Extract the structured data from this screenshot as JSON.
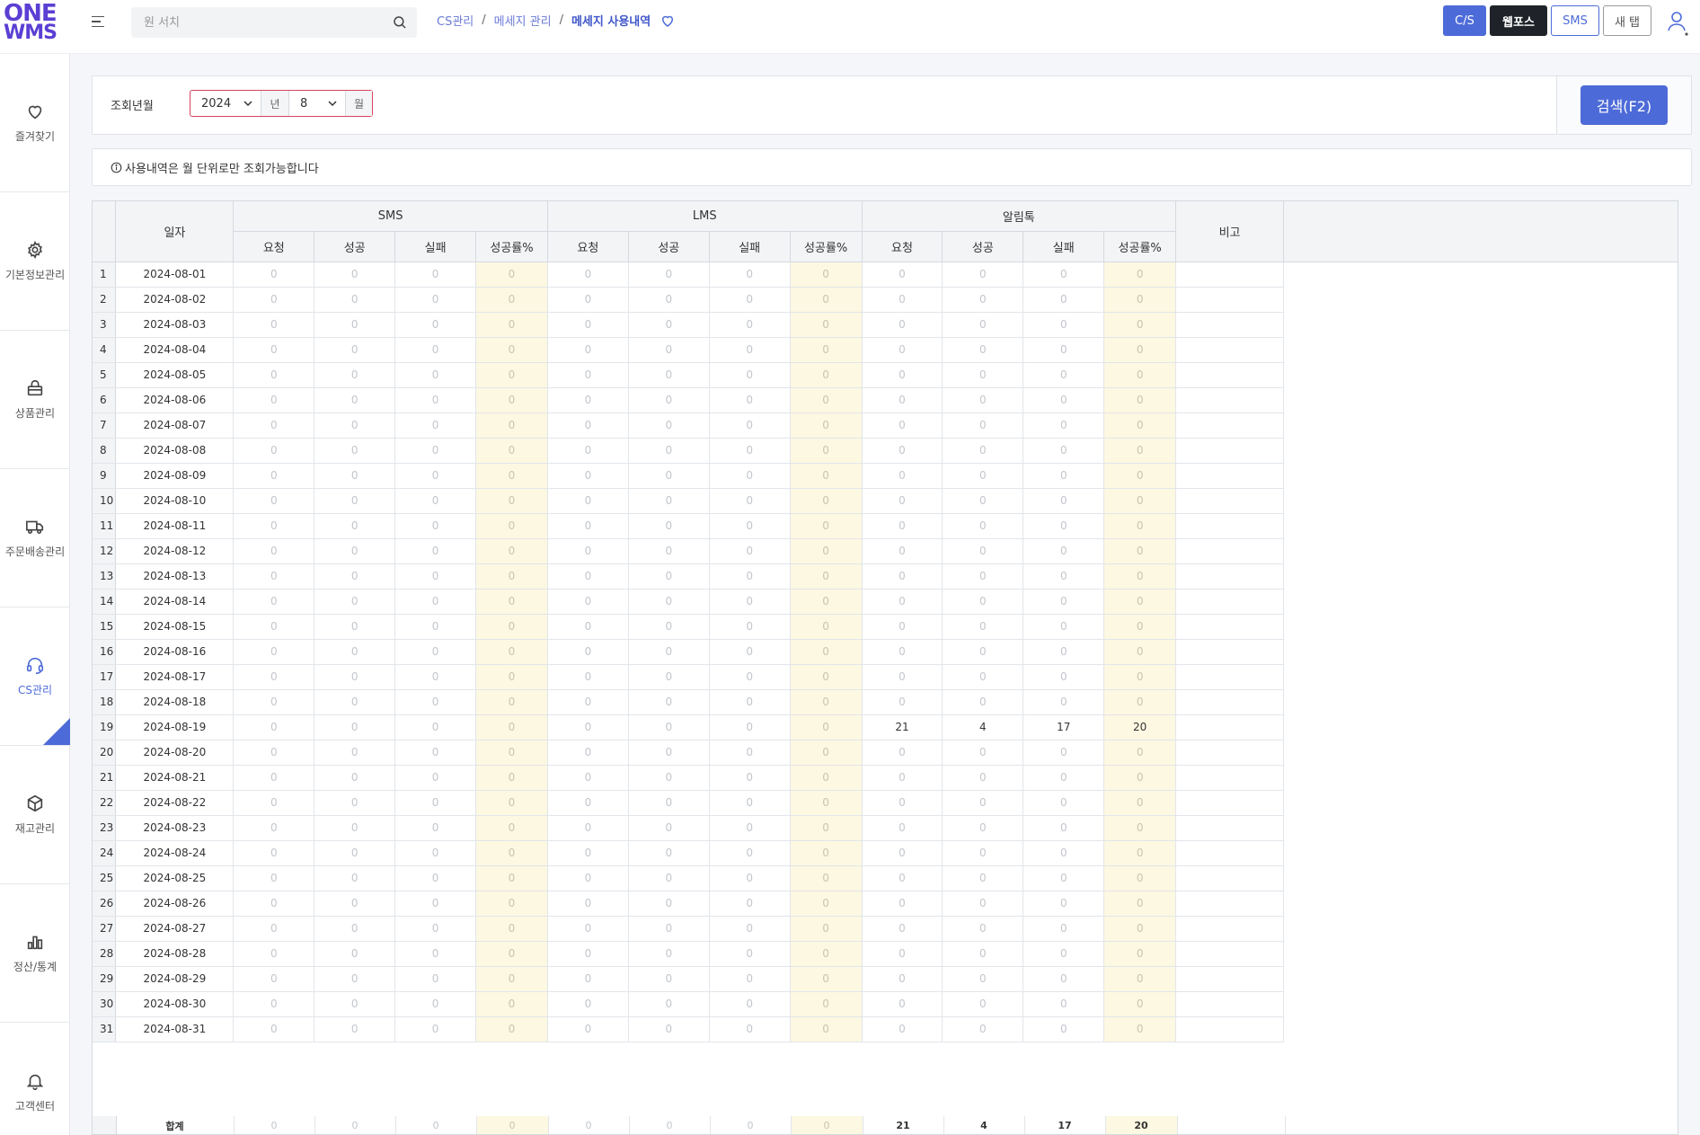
{
  "header": {
    "logo_line1": "ONE",
    "logo_line2": "WMS",
    "search_placeholder": "원 서치",
    "breadcrumb": [
      "CS관리",
      "메세지 관리",
      "메세지 사용내역"
    ],
    "buttons": [
      "C/S",
      "웹포스",
      "SMS",
      "새 탭"
    ]
  },
  "sidebar": {
    "items": [
      {
        "label": "즐겨찾기",
        "icon": "heart-icon"
      },
      {
        "label": "기본정보관리",
        "icon": "gear-icon"
      },
      {
        "label": "상품관리",
        "icon": "product-box-icon"
      },
      {
        "label": "주문배송관리",
        "icon": "truck-icon"
      },
      {
        "label": "CS관리",
        "icon": "headset-icon",
        "active": true
      },
      {
        "label": "재고관리",
        "icon": "cube-icon"
      },
      {
        "label": "정산/통계",
        "icon": "bar-chart-icon"
      },
      {
        "label": "고객센터",
        "icon": "bell-icon"
      }
    ]
  },
  "filter": {
    "label": "조회년월",
    "year": "2024",
    "year_unit": "년",
    "month": "8",
    "month_unit": "월",
    "search_button": "검색(F2)"
  },
  "notice": "사용내역은 월 단위로만 조회가능합니다",
  "table": {
    "date_header": "일자",
    "note_header": "비고",
    "groups": [
      "SMS",
      "LMS",
      "알림톡"
    ],
    "sub_headers": [
      "요청",
      "성공",
      "실패",
      "성공률%"
    ],
    "rows": [
      {
        "n": "1",
        "date": "2024-08-01"
      },
      {
        "n": "2",
        "date": "2024-08-02"
      },
      {
        "n": "3",
        "date": "2024-08-03"
      },
      {
        "n": "4",
        "date": "2024-08-04"
      },
      {
        "n": "5",
        "date": "2024-08-05"
      },
      {
        "n": "6",
        "date": "2024-08-06"
      },
      {
        "n": "7",
        "date": "2024-08-07"
      },
      {
        "n": "8",
        "date": "2024-08-08"
      },
      {
        "n": "9",
        "date": "2024-08-09"
      },
      {
        "n": "10",
        "date": "2024-08-10"
      },
      {
        "n": "11",
        "date": "2024-08-11"
      },
      {
        "n": "12",
        "date": "2024-08-12"
      },
      {
        "n": "13",
        "date": "2024-08-13"
      },
      {
        "n": "14",
        "date": "2024-08-14"
      },
      {
        "n": "15",
        "date": "2024-08-15"
      },
      {
        "n": "16",
        "date": "2024-08-16"
      },
      {
        "n": "17",
        "date": "2024-08-17"
      },
      {
        "n": "18",
        "date": "2024-08-18"
      },
      {
        "n": "19",
        "date": "2024-08-19",
        "alim": [
          "21",
          "4",
          "17",
          "20"
        ]
      },
      {
        "n": "20",
        "date": "2024-08-20"
      },
      {
        "n": "21",
        "date": "2024-08-21"
      },
      {
        "n": "22",
        "date": "2024-08-22"
      },
      {
        "n": "23",
        "date": "2024-08-23"
      },
      {
        "n": "24",
        "date": "2024-08-24"
      },
      {
        "n": "25",
        "date": "2024-08-25"
      },
      {
        "n": "26",
        "date": "2024-08-26"
      },
      {
        "n": "27",
        "date": "2024-08-27"
      },
      {
        "n": "28",
        "date": "2024-08-28"
      },
      {
        "n": "29",
        "date": "2024-08-29"
      },
      {
        "n": "30",
        "date": "2024-08-30"
      },
      {
        "n": "31",
        "date": "2024-08-31"
      }
    ],
    "zero": "0",
    "total_label": "합계",
    "totals": {
      "sms": [
        "0",
        "0",
        "0",
        "0"
      ],
      "lms": [
        "0",
        "0",
        "0",
        "0"
      ],
      "alim": [
        "21",
        "4",
        "17",
        "20"
      ]
    }
  },
  "colors": {
    "brand": "#5b3fd3",
    "accent": "#4d6bd8",
    "rate_bg": "#fcf8e1"
  }
}
